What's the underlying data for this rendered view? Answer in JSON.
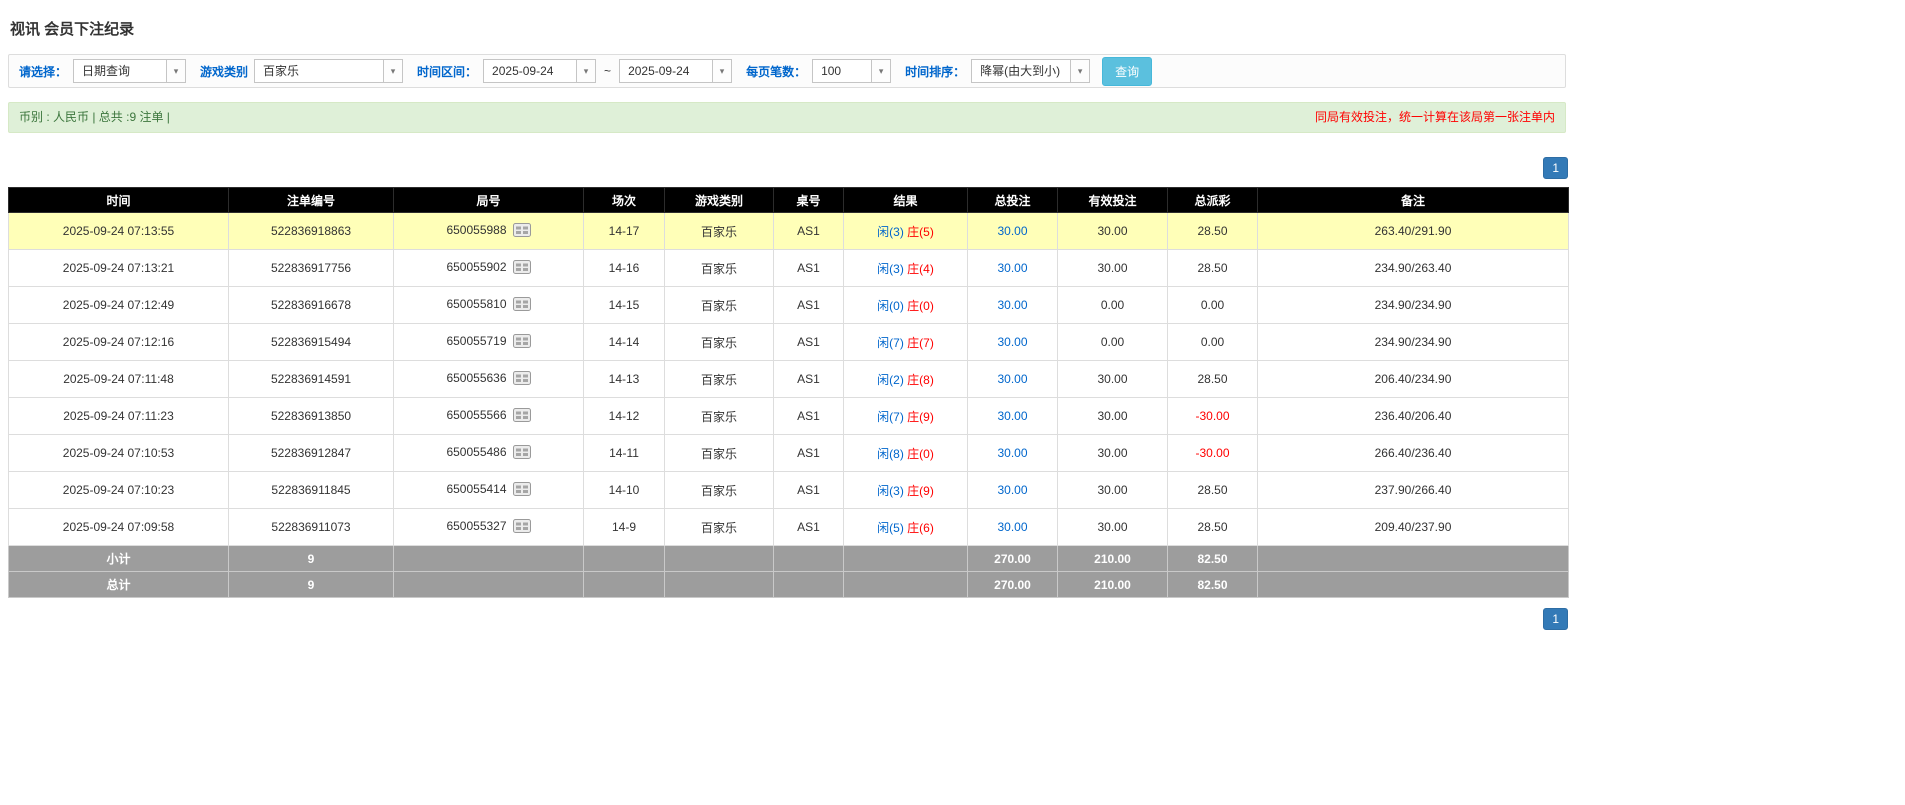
{
  "page": {
    "title": "视讯 会员下注纪录"
  },
  "filters": {
    "select_label": "请选择：",
    "select_value": "日期查询",
    "game_type_label": "游戏类别",
    "game_type_value": "百家乐",
    "time_range_label": "时间区间：",
    "date_from": "2025-09-24",
    "tilde": "~",
    "date_to": "2025-09-24",
    "page_size_label": "每页笔数：",
    "page_size_value": "100",
    "sort_label": "时间排序：",
    "sort_value": "降幂(由大到小)",
    "search_button": "查询"
  },
  "summary": {
    "left": "币别 : 人民币 | 总共 :9 注单 |",
    "right": "同局有效投注，统一计算在该局第一张注单内"
  },
  "pagination": {
    "page": "1"
  },
  "icons": {
    "combo_arrow": "▾",
    "round_detail": "round-detail-icon"
  },
  "colors": {
    "header_bg": "#000000",
    "highlight_row": "#ffffb8",
    "footer_bg": "#9d9d9d",
    "link_blue": "#0066cc",
    "negative_red": "#ff0000",
    "summary_bg": "#dff0d8",
    "search_button_bg": "#5bc0de",
    "pagination_bg": "#337ab7"
  },
  "table": {
    "headers": [
      "时间",
      "注单编号",
      "局号",
      "场次",
      "游戏类别",
      "桌号",
      "结果",
      "总投注",
      "有效投注",
      "总派彩",
      "备注"
    ],
    "rows": [
      {
        "time": "2025-09-24 07:13:55",
        "bet_id": "522836918863",
        "round_id": "650055988",
        "session": "14-17",
        "game": "百家乐",
        "table_no": "AS1",
        "player": "闲(3)",
        "banker": "庄(5)",
        "total_bet": "30.00",
        "valid_bet": "30.00",
        "payout": "28.50",
        "remark": "263.40/291.90",
        "highlight": true
      },
      {
        "time": "2025-09-24 07:13:21",
        "bet_id": "522836917756",
        "round_id": "650055902",
        "session": "14-16",
        "game": "百家乐",
        "table_no": "AS1",
        "player": "闲(3)",
        "banker": "庄(4)",
        "total_bet": "30.00",
        "valid_bet": "30.00",
        "payout": "28.50",
        "remark": "234.90/263.40",
        "highlight": false
      },
      {
        "time": "2025-09-24 07:12:49",
        "bet_id": "522836916678",
        "round_id": "650055810",
        "session": "14-15",
        "game": "百家乐",
        "table_no": "AS1",
        "player": "闲(0)",
        "banker": "庄(0)",
        "total_bet": "30.00",
        "valid_bet": "0.00",
        "payout": "0.00",
        "remark": "234.90/234.90",
        "highlight": false
      },
      {
        "time": "2025-09-24 07:12:16",
        "bet_id": "522836915494",
        "round_id": "650055719",
        "session": "14-14",
        "game": "百家乐",
        "table_no": "AS1",
        "player": "闲(7)",
        "banker": "庄(7)",
        "total_bet": "30.00",
        "valid_bet": "0.00",
        "payout": "0.00",
        "remark": "234.90/234.90",
        "highlight": false
      },
      {
        "time": "2025-09-24 07:11:48",
        "bet_id": "522836914591",
        "round_id": "650055636",
        "session": "14-13",
        "game": "百家乐",
        "table_no": "AS1",
        "player": "闲(2)",
        "banker": "庄(8)",
        "total_bet": "30.00",
        "valid_bet": "30.00",
        "payout": "28.50",
        "remark": "206.40/234.90",
        "highlight": false
      },
      {
        "time": "2025-09-24 07:11:23",
        "bet_id": "522836913850",
        "round_id": "650055566",
        "session": "14-12",
        "game": "百家乐",
        "table_no": "AS1",
        "player": "闲(7)",
        "banker": "庄(9)",
        "total_bet": "30.00",
        "valid_bet": "30.00",
        "payout": "-30.00",
        "remark": "236.40/206.40",
        "highlight": false
      },
      {
        "time": "2025-09-24 07:10:53",
        "bet_id": "522836912847",
        "round_id": "650055486",
        "session": "14-11",
        "game": "百家乐",
        "table_no": "AS1",
        "player": "闲(8)",
        "banker": "庄(0)",
        "total_bet": "30.00",
        "valid_bet": "30.00",
        "payout": "-30.00",
        "remark": "266.40/236.40",
        "highlight": false
      },
      {
        "time": "2025-09-24 07:10:23",
        "bet_id": "522836911845",
        "round_id": "650055414",
        "session": "14-10",
        "game": "百家乐",
        "table_no": "AS1",
        "player": "闲(3)",
        "banker": "庄(9)",
        "total_bet": "30.00",
        "valid_bet": "30.00",
        "payout": "28.50",
        "remark": "237.90/266.40",
        "highlight": false
      },
      {
        "time": "2025-09-24 07:09:58",
        "bet_id": "522836911073",
        "round_id": "650055327",
        "session": "14-9",
        "game": "百家乐",
        "table_no": "AS1",
        "player": "闲(5)",
        "banker": "庄(6)",
        "total_bet": "30.00",
        "valid_bet": "30.00",
        "payout": "28.50",
        "remark": "209.40/237.90",
        "highlight": false
      }
    ],
    "subtotal": {
      "label": "小计",
      "count": "9",
      "total_bet": "270.00",
      "valid_bet": "210.00",
      "payout": "82.50"
    },
    "total": {
      "label": "总计",
      "count": "9",
      "total_bet": "270.00",
      "valid_bet": "210.00",
      "payout": "82.50"
    }
  }
}
